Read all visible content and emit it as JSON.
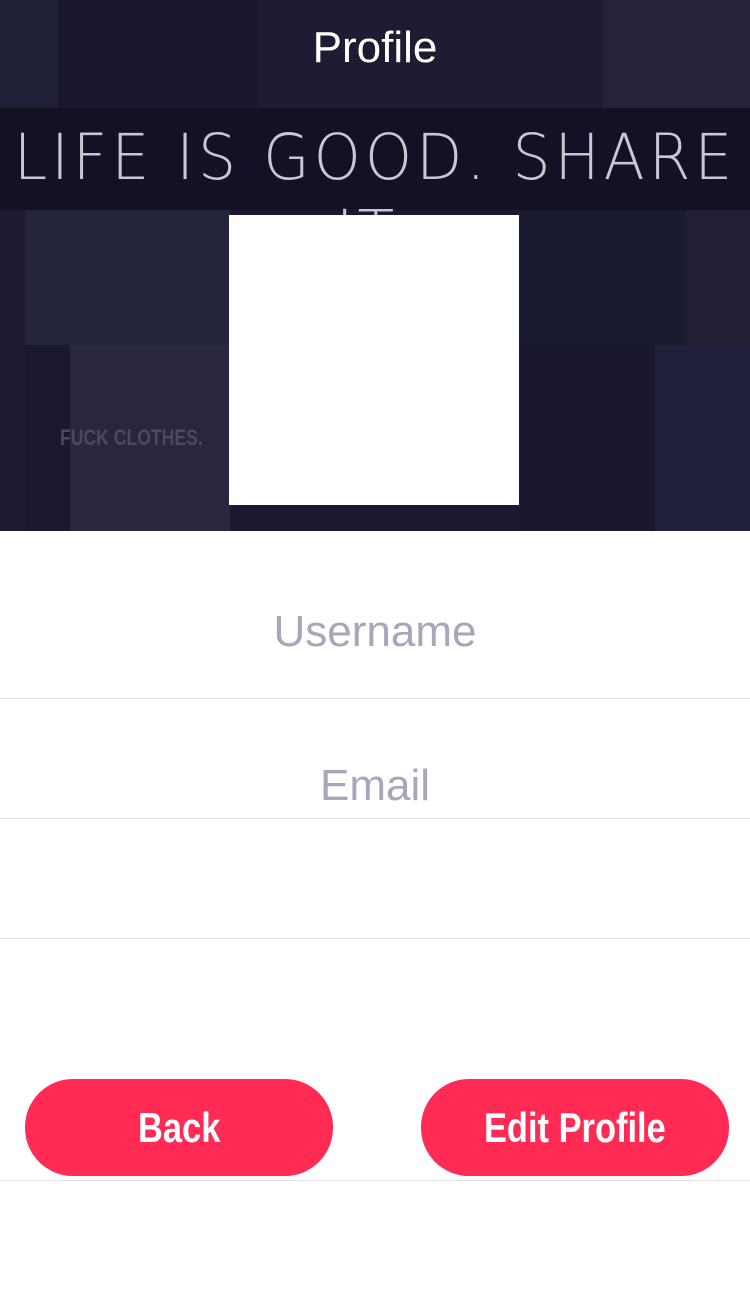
{
  "header": {
    "title": "Profile",
    "banner_text": "LIFE IS GOOD. SHARE IT.",
    "graffiti_text": "FUCK CLOTHES."
  },
  "form": {
    "username_placeholder": "Username",
    "email_placeholder": "Email",
    "extra_placeholder": ""
  },
  "actions": {
    "back_label": "Back",
    "edit_label": "Edit Profile"
  },
  "colors": {
    "accent": "#ff2b55",
    "cover_bg": "#1c1b31",
    "placeholder": "#a9a6bb"
  }
}
